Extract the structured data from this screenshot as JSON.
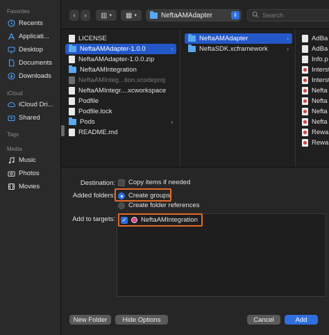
{
  "sidebar": {
    "favorites_label": "Favorites",
    "favorites": [
      {
        "label": "Recents",
        "icon": "clock-icon"
      },
      {
        "label": "Applicati...",
        "icon": "applications-icon"
      },
      {
        "label": "Desktop",
        "icon": "desktop-icon"
      },
      {
        "label": "Documents",
        "icon": "document-icon"
      },
      {
        "label": "Downloads",
        "icon": "download-icon"
      }
    ],
    "icloud_label": "iCloud",
    "icloud": [
      {
        "label": "iCloud Dri...",
        "icon": "cloud-icon"
      },
      {
        "label": "Shared",
        "icon": "shared-folder-icon"
      }
    ],
    "tags_label": "Tags",
    "media_label": "Media",
    "media": [
      {
        "label": "Music",
        "icon": "music-icon"
      },
      {
        "label": "Photos",
        "icon": "camera-icon"
      },
      {
        "label": "Movies",
        "icon": "film-icon"
      }
    ]
  },
  "toolbar": {
    "back_glyph": "‹",
    "forward_glyph": "›",
    "view_glyph": "▥",
    "group_glyph": "▦",
    "path_title": "NeftaAMAdapter",
    "search_placeholder": "Search"
  },
  "columns": {
    "col1": [
      {
        "label": "LICENSE",
        "type": "file"
      },
      {
        "label": "NeftaAMAdapter-1.0.0",
        "type": "folder",
        "selected": true
      },
      {
        "label": "NeftaAMAdapter-1.0.0.zip",
        "type": "file"
      },
      {
        "label": "NeftaAMIntegration",
        "type": "folder"
      },
      {
        "label": "NeftaAMInteg...tion.xcodeproj",
        "type": "file",
        "dim": true
      },
      {
        "label": "NeftaAMIntegr....xcworkspace",
        "type": "file"
      },
      {
        "label": "Podfile",
        "type": "file"
      },
      {
        "label": "Podfile.lock",
        "type": "file"
      },
      {
        "label": "Pods",
        "type": "folder"
      },
      {
        "label": "README.md",
        "type": "file"
      }
    ],
    "col2": [
      {
        "label": "NeftaAMAdapter",
        "type": "folder",
        "selected": true
      },
      {
        "label": "NeftaSDK.xcframework",
        "type": "folder"
      }
    ],
    "col3": [
      {
        "label": "AdBa"
      },
      {
        "label": "AdBa"
      },
      {
        "label": "Info.p"
      },
      {
        "label": "Interst"
      },
      {
        "label": "Interst"
      },
      {
        "label": "Nefta"
      },
      {
        "label": "Nefta"
      },
      {
        "label": "Nefta"
      },
      {
        "label": "Nefta"
      },
      {
        "label": "Rewa"
      },
      {
        "label": "Rewa"
      }
    ],
    "arrow_glyph": "›"
  },
  "options": {
    "destination_label": "Destination:",
    "copy_items_label": "Copy items if needed",
    "copy_items_checked": false,
    "added_folders_label": "Added folders:",
    "create_groups_label": "Create groups",
    "create_folder_refs_label": "Create folder references",
    "selected_radio": "create_groups",
    "add_to_targets_label": "Add to targets:",
    "target_name": "NeftaAMIntegration",
    "target_checked": true,
    "check_glyph": "✓"
  },
  "buttons": {
    "new_folder": "New Folder",
    "hide_options": "Hide Options",
    "cancel": "Cancel",
    "add": "Add"
  },
  "colors": {
    "accent": "#2f6fe0",
    "selection": "#2458c9",
    "highlight_box": "#e36a2a",
    "folder": "#5aa8f0"
  }
}
